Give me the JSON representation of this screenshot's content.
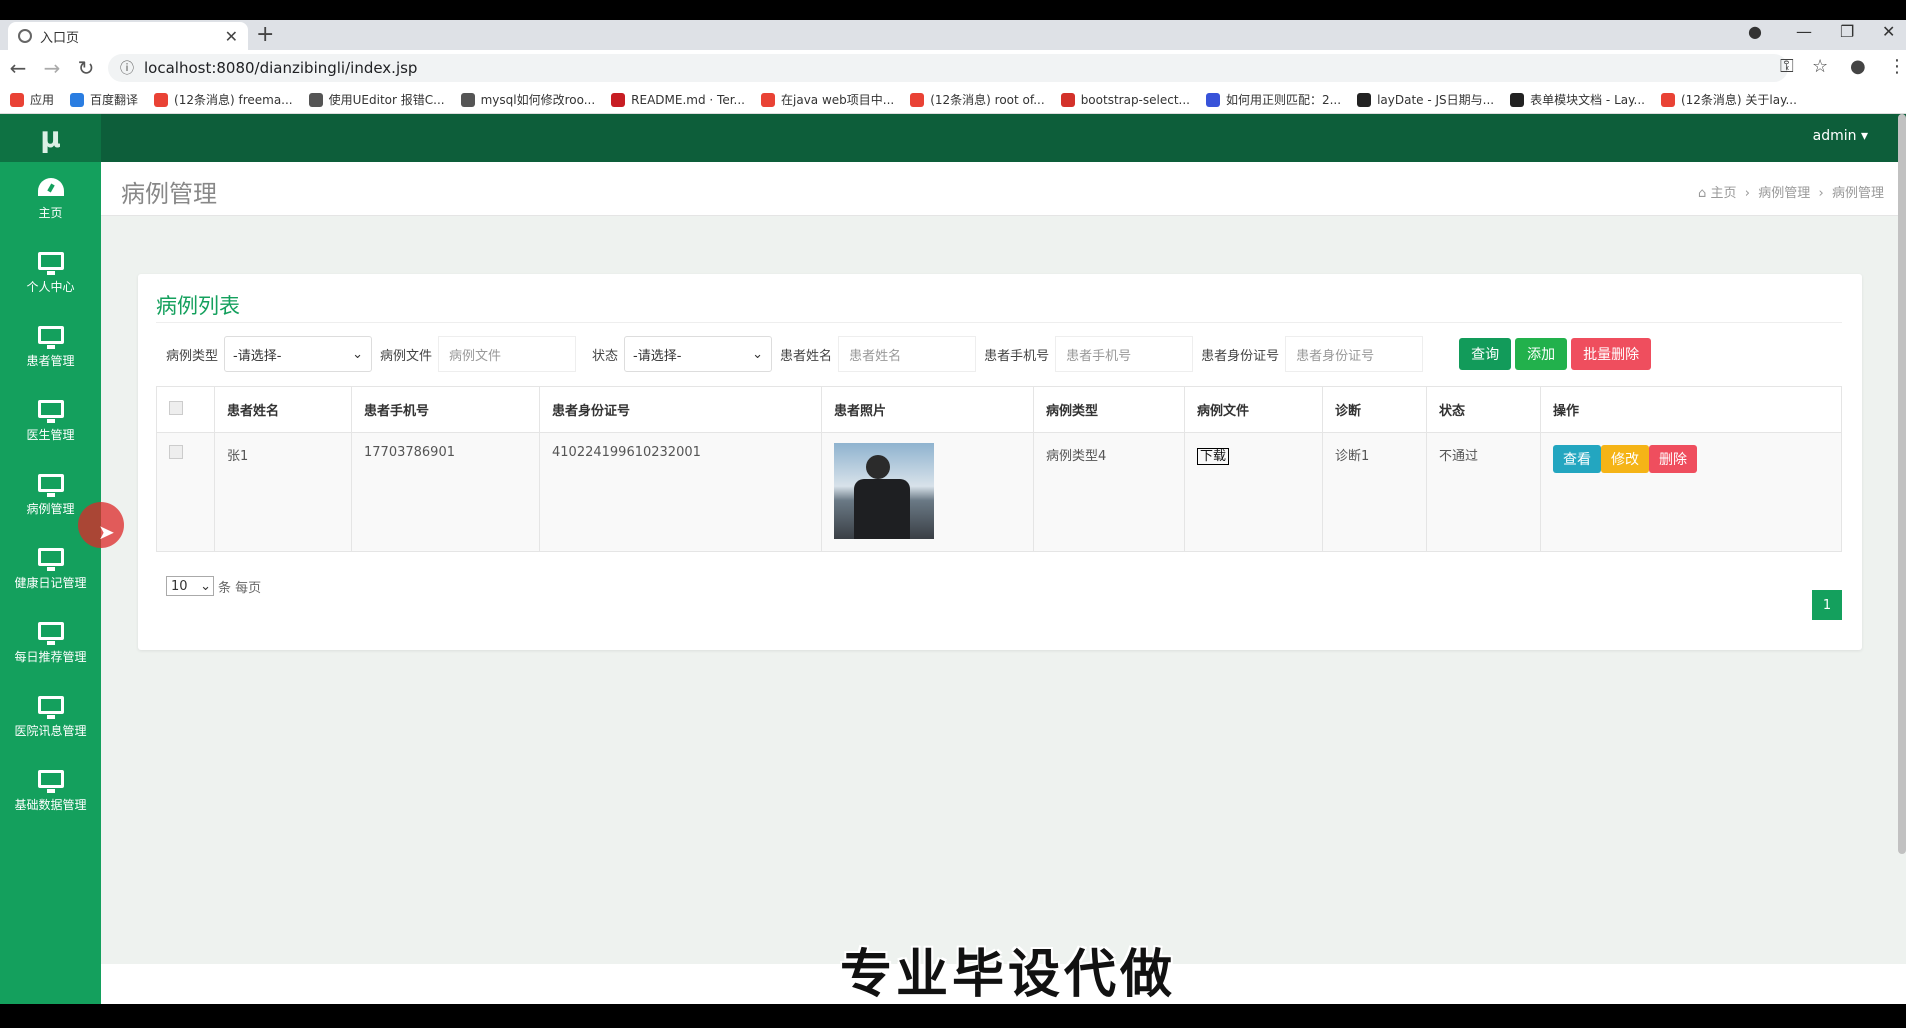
{
  "browser": {
    "tab_title": "入口页",
    "url": "localhost:8080/dianzibingli/index.jsp",
    "bookmarks": [
      {
        "label": "应用",
        "color": "#e94235"
      },
      {
        "label": "百度翻译",
        "color": "#2a7de1"
      },
      {
        "label": "(12条消息) freema...",
        "color": "#e94235"
      },
      {
        "label": "使用UEditor 报错C...",
        "color": "#555555"
      },
      {
        "label": "mysql如何修改roo...",
        "color": "#555555"
      },
      {
        "label": "README.md · Ter...",
        "color": "#c71d23"
      },
      {
        "label": "在java web项目中...",
        "color": "#e94235"
      },
      {
        "label": "(12条消息) root of...",
        "color": "#e94235"
      },
      {
        "label": "bootstrap-select...",
        "color": "#d3312a"
      },
      {
        "label": "如何用正则匹配：2...",
        "color": "#3853d9"
      },
      {
        "label": "layDate - JS日期与...",
        "color": "#222222"
      },
      {
        "label": "表单模块文档 - Lay...",
        "color": "#222222"
      },
      {
        "label": "(12条消息) 关于lay...",
        "color": "#e94235"
      }
    ]
  },
  "app": {
    "logo": "μ",
    "user": "admin ▾",
    "sidebar": [
      {
        "label": "主页",
        "icon": "dashboard-icon"
      },
      {
        "label": "个人中心",
        "icon": "monitor-icon"
      },
      {
        "label": "患者管理",
        "icon": "monitor-icon"
      },
      {
        "label": "医生管理",
        "icon": "monitor-icon"
      },
      {
        "label": "病例管理",
        "icon": "monitor-icon"
      },
      {
        "label": "健康日记管理",
        "icon": "monitor-icon"
      },
      {
        "label": "每日推荐管理",
        "icon": "monitor-icon"
      },
      {
        "label": "医院讯息管理",
        "icon": "monitor-icon"
      },
      {
        "label": "基础数据管理",
        "icon": "monitor-icon"
      }
    ],
    "page_title": "病例管理",
    "breadcrumb": [
      "主页",
      "病例管理",
      "病例管理"
    ],
    "panel_title": "病例列表",
    "filters": {
      "type_label": "病例类型",
      "type_value": "-请选择-",
      "file_label": "病例文件",
      "file_placeholder": "病例文件",
      "status_label": "状态",
      "status_value": "-请选择-",
      "name_label": "患者姓名",
      "name_placeholder": "患者姓名",
      "phone_label": "患者手机号",
      "phone_placeholder": "患者手机号",
      "id_label": "患者身份证号",
      "id_placeholder": "患者身份证号",
      "query": "查询",
      "add": "添加",
      "batch_delete": "批量删除"
    },
    "colors": {
      "primary": "#14a05d",
      "header": "#0d5e3a",
      "query": "#129b5a",
      "add": "#22b14c",
      "delete": "#ef4e5e",
      "view": "#23a6c0",
      "edit": "#f5b417"
    },
    "table": {
      "headers": [
        "患者姓名",
        "患者手机号",
        "患者身份证号",
        "患者照片",
        "病例类型",
        "病例文件",
        "诊断",
        "状态",
        "操作"
      ],
      "row": {
        "name": "张1",
        "phone": "17703786901",
        "idcard": "410224199610232001",
        "type": "病例类型4",
        "file": "下载",
        "diagnosis": "诊断1",
        "status": "不通过",
        "view": "查看",
        "edit": "修改",
        "delete": "删除"
      }
    },
    "pagination": {
      "per_page": "10",
      "per_page_suffix": "条 每页",
      "page": "1"
    },
    "overlay": "专业毕设代做"
  }
}
